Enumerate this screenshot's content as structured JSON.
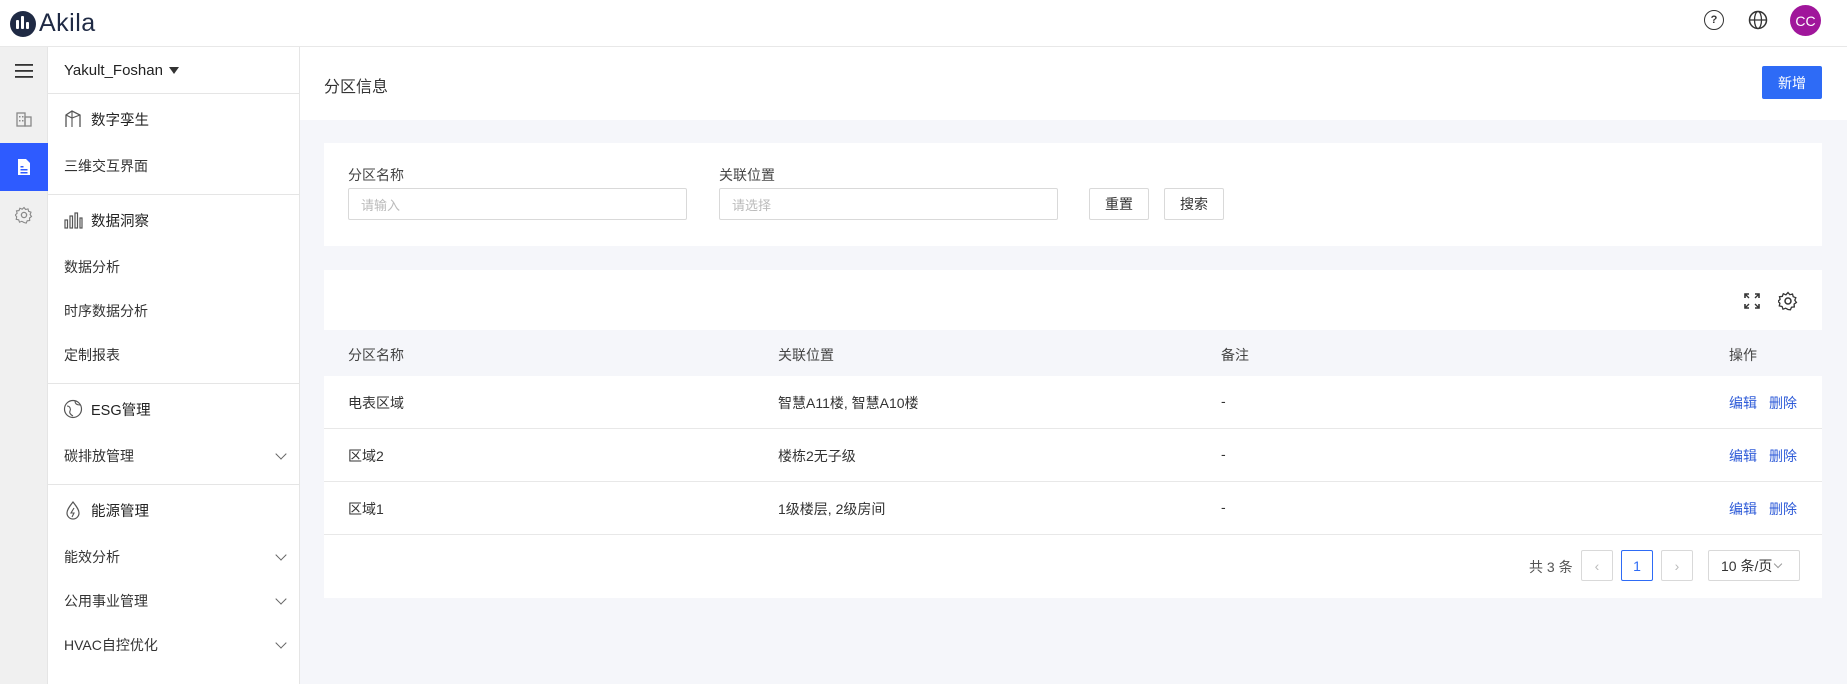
{
  "app": {
    "brand": "Akila",
    "avatar_initials": "CC"
  },
  "topbar": {
    "help_icon": "help-circle-icon",
    "globe_icon": "globe-icon"
  },
  "sidebar": {
    "org_name": "Yakult_Foshan",
    "groups": [
      {
        "title": "数字孪生",
        "icon": "building-model-icon",
        "items": [
          {
            "label": "三维交互界面",
            "expandable": false
          }
        ]
      },
      {
        "title": "数据洞察",
        "icon": "bar-chart-icon",
        "items": [
          {
            "label": "数据分析",
            "expandable": false
          },
          {
            "label": "时序数据分析",
            "expandable": false
          },
          {
            "label": "定制报表",
            "expandable": false
          }
        ]
      },
      {
        "title": "ESG管理",
        "icon": "globe-leaf-icon",
        "items": [
          {
            "label": "碳排放管理",
            "expandable": true
          }
        ]
      },
      {
        "title": "能源管理",
        "icon": "energy-drop-icon",
        "items": [
          {
            "label": "能效分析",
            "expandable": true
          },
          {
            "label": "公用事业管理",
            "expandable": true
          },
          {
            "label": "HVAC自控优化",
            "expandable": true
          }
        ]
      }
    ]
  },
  "page": {
    "title": "分区信息",
    "add_label": "新增"
  },
  "filter": {
    "name_label": "分区名称",
    "name_placeholder": "请输入",
    "location_label": "关联位置",
    "location_placeholder": "请选择",
    "reset_label": "重置",
    "search_label": "搜索"
  },
  "table": {
    "headers": [
      "分区名称",
      "关联位置",
      "备注",
      "操作"
    ],
    "rows": [
      {
        "name": "电表区域",
        "location": "智慧A11楼, 智慧A10楼",
        "remark": "-"
      },
      {
        "name": "区域2",
        "location": "楼栋2无子级",
        "remark": "-"
      },
      {
        "name": "区域1",
        "location": "1级楼层, 2级房间",
        "remark": "-"
      }
    ],
    "edit_label": "编辑",
    "delete_label": "删除"
  },
  "pagination": {
    "total_text": "共 3 条",
    "current_page": "1",
    "page_size": "10 条/页"
  },
  "colors": {
    "primary": "#2e6bf6",
    "avatar": "#a0169b",
    "brand": "#1f2a44"
  }
}
